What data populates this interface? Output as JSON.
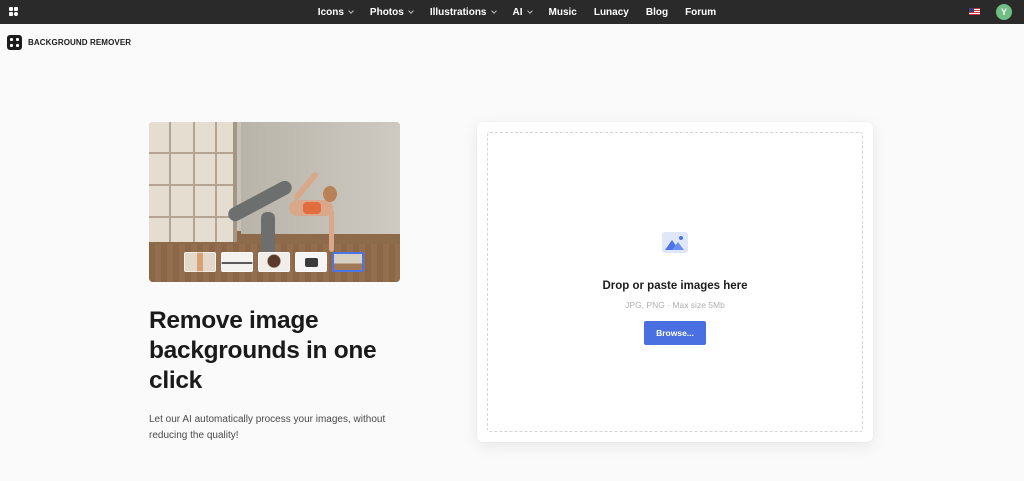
{
  "nav": {
    "items": [
      {
        "label": "Icons",
        "has_menu": true
      },
      {
        "label": "Photos",
        "has_menu": true
      },
      {
        "label": "Illustrations",
        "has_menu": true
      },
      {
        "label": "AI",
        "has_menu": true
      },
      {
        "label": "Music",
        "has_menu": false
      },
      {
        "label": "Lunacy",
        "has_menu": false
      },
      {
        "label": "Blog",
        "has_menu": false
      },
      {
        "label": "Forum",
        "has_menu": false
      }
    ],
    "language_icon": "us-flag-icon",
    "avatar_initial": "Y",
    "avatar_color": "#6fbe83"
  },
  "brand": {
    "label": "BACKGROUND REMOVER",
    "icon": "sparkle-grid-icon"
  },
  "hero": {
    "headline": "Remove image backgrounds in one click",
    "subtext": "Let our AI automatically process your images, without reducing the quality!",
    "sample_thumbnails": [
      "woman-portrait",
      "product-shoes",
      "woman-curly-hair",
      "camera",
      "yoga-room"
    ],
    "selected_thumbnail_index": 4
  },
  "upload": {
    "title": "Drop or paste images here",
    "hint": "JPG, PNG · Max size 5Mb",
    "browse_label": "Browse...",
    "accent_color": "#4a6fe0"
  }
}
